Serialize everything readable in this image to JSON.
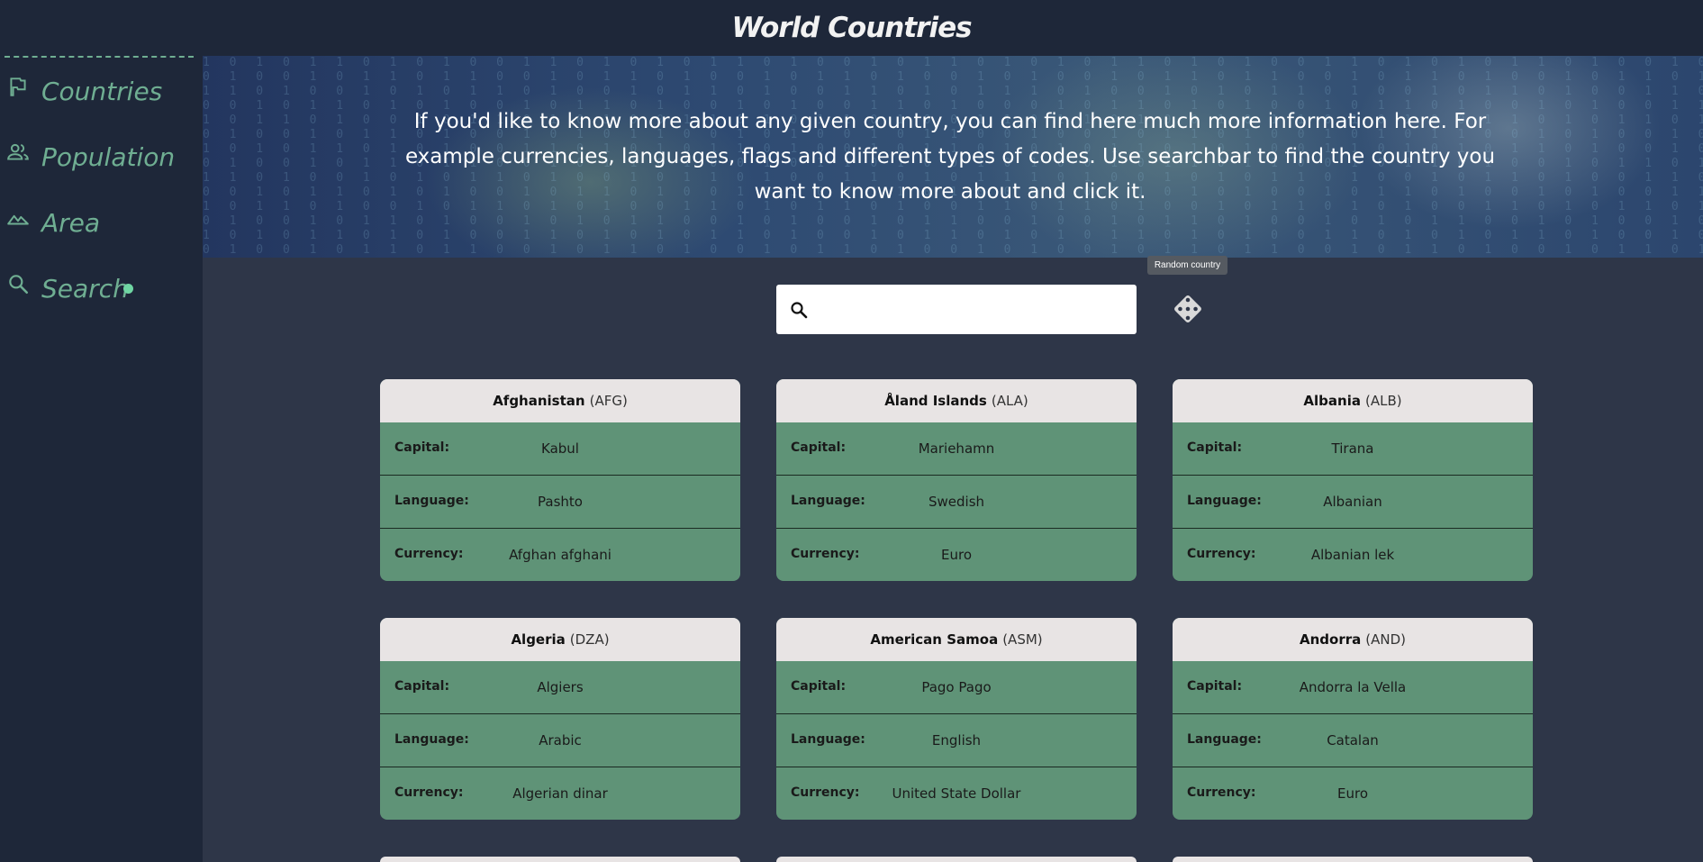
{
  "header": {
    "title": "World Countries"
  },
  "sidebar": {
    "items": [
      {
        "label": "Countries",
        "icon": "flag-icon"
      },
      {
        "label": "Population",
        "icon": "people-icon"
      },
      {
        "label": "Area",
        "icon": "terrain-icon"
      },
      {
        "label": "Search",
        "icon": "search-icon",
        "active": true
      }
    ]
  },
  "banner": {
    "text": "If you'd like to know more about any given country, you can find here much more information here. For example currencies, languages, flags and different types of codes. Use searchbar to find the country you want to know more about and click it."
  },
  "search": {
    "value": "",
    "placeholder": ""
  },
  "random": {
    "tooltip": "Random country",
    "icon": "dice-icon"
  },
  "labels": {
    "capital": "Capital:",
    "language": "Language:",
    "currency": "Currency:"
  },
  "countries": [
    {
      "name": "Afghanistan",
      "code": "(AFG)",
      "capital": "Kabul",
      "language": "Pashto",
      "currency": "Afghan afghani"
    },
    {
      "name": "Åland Islands",
      "code": "(ALA)",
      "capital": "Mariehamn",
      "language": "Swedish",
      "currency": "Euro"
    },
    {
      "name": "Albania",
      "code": "(ALB)",
      "capital": "Tirana",
      "language": "Albanian",
      "currency": "Albanian lek"
    },
    {
      "name": "Algeria",
      "code": "(DZA)",
      "capital": "Algiers",
      "language": "Arabic",
      "currency": "Algerian dinar"
    },
    {
      "name": "American Samoa",
      "code": "(ASM)",
      "capital": "Pago Pago",
      "language": "English",
      "currency": "United State Dollar"
    },
    {
      "name": "Andorra",
      "code": "(AND)",
      "capital": "Andorra la Vella",
      "language": "Catalan",
      "currency": "Euro"
    }
  ],
  "colors": {
    "accent": "#6fae92",
    "card": "#5f9377",
    "card_head": "#e8e4e4",
    "bg": "#2e3648",
    "sidebar": "#1e2739"
  }
}
